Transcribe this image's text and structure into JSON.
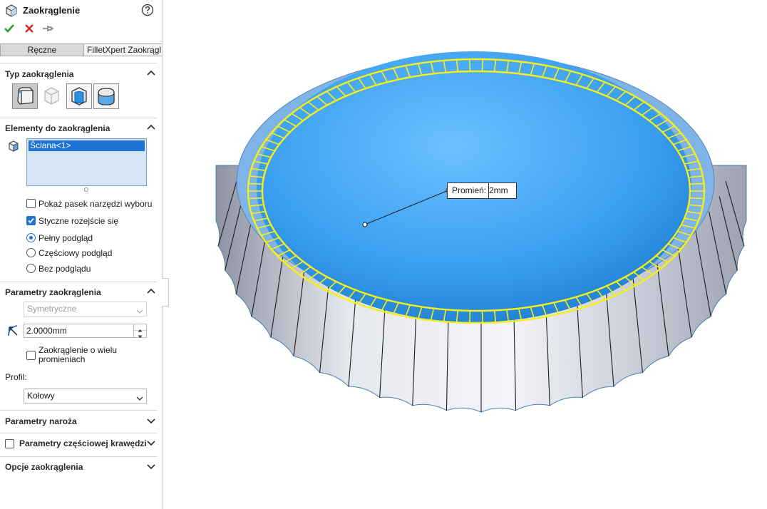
{
  "panel": {
    "title": "Zaokrąglenie",
    "tabs": {
      "manual": "Ręczne",
      "filletxpert": "FilletXpert Zaokrągl"
    },
    "fillet_type": {
      "heading": "Typ zaokrąglenia"
    },
    "items": {
      "heading": "Elementy do zaokrąglenia",
      "selection": [
        "Ściana<1>"
      ],
      "show_toolbar": "Pokaż pasek narzędzi wyboru",
      "tangent_propagation": "Styczne rozejście się",
      "full_preview": "Pełny podgląd",
      "partial_preview": "Częściowy podgląd",
      "no_preview": "Bez podglądu"
    },
    "params": {
      "heading": "Parametry zaokrąglenia",
      "symmetric": "Symetryczne",
      "radius_value": "2.0000mm",
      "multi_radius": [
        "Zaokrąglenie o wielu",
        "promieniach"
      ],
      "profile_label": "Profil:",
      "profile_value": "Kołowy"
    },
    "corner_params": "Parametry naroża",
    "partial_edge_params": "Parametry częściowej krawędzi",
    "fillet_options": "Opcje zaokrąglenia"
  },
  "viewport": {
    "callout_label": "Promień:",
    "callout_value": "2mm"
  },
  "colors": {
    "accent": "#1e73d4",
    "selection_yellow": "#f4ef1a",
    "face_blue": "#2a8fe6"
  }
}
